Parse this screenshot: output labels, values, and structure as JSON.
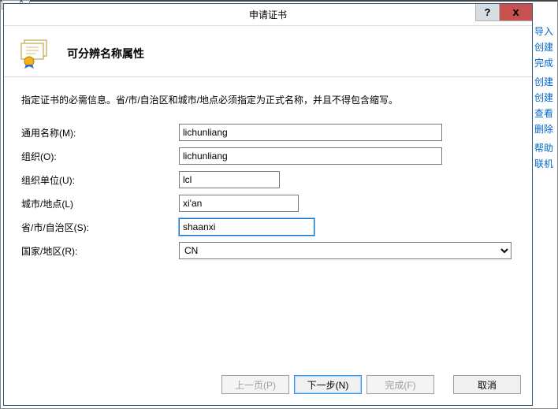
{
  "window": {
    "title": "申请证书",
    "help_symbol": "?",
    "close_symbol": "x"
  },
  "header": {
    "heading": "可分辨名称属性"
  },
  "content": {
    "description": "指定证书的必需信息。省/市/自治区和城市/地点必须指定为正式名称，并且不得包含缩写。"
  },
  "form": {
    "common_name": {
      "label": "通用名称(M):",
      "value": "lichunliang"
    },
    "organization": {
      "label": "组织(O):",
      "value": "lichunliang"
    },
    "org_unit": {
      "label": "组织单位(U):",
      "value": "lcl"
    },
    "city": {
      "label": "城市/地点(L)",
      "value": "xi'an"
    },
    "state": {
      "label": "省/市/自治区(S):",
      "value": "shaanxi"
    },
    "country": {
      "label": "国家/地区(R):",
      "value": "CN"
    }
  },
  "buttons": {
    "previous": "上一页(P)",
    "next": "下一步(N)",
    "finish": "完成(F)",
    "cancel": "取消"
  },
  "side_links": [
    "导入",
    "创建",
    "完成",
    "创建",
    "创建",
    "查看",
    "删除",
    "帮助",
    "联机"
  ]
}
